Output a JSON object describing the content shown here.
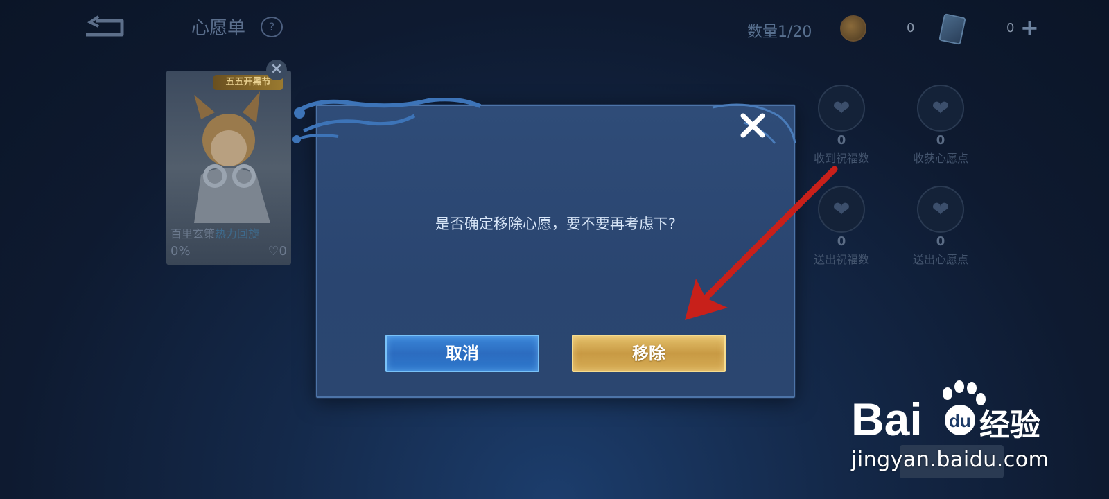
{
  "header": {
    "title": "心愿单",
    "help_icon_glyph": "?",
    "count_label": "数量1/20",
    "coin_value": "0",
    "card_value": "0",
    "add_glyph": "+"
  },
  "hero_card": {
    "badge": "五五开黑节",
    "name": "百里玄策",
    "skin": "热力回旋",
    "progress": "0%",
    "likes": "0",
    "close_glyph": "×"
  },
  "stats": [
    {
      "value": "0",
      "label": "收到祝福数"
    },
    {
      "value": "0",
      "label": "收获心愿点"
    },
    {
      "value": "0",
      "label": "送出祝福数"
    },
    {
      "value": "0",
      "label": "送出心愿点"
    }
  ],
  "dialog": {
    "message": "是否确定移除心愿，要不要再考虑下?",
    "cancel_label": "取消",
    "remove_label": "移除"
  },
  "watermark": {
    "brand": "Baidu经验",
    "url": "jingyan.baidu.com"
  },
  "colors": {
    "cancel_button": "#2f74c8",
    "remove_button": "#d4aa55",
    "annotation_arrow": "#c8201a",
    "dialog_bg": "#2d4a75"
  },
  "icons": [
    "back-icon",
    "help-icon",
    "coin-icon",
    "card-icon",
    "add-icon",
    "close-icon",
    "heart-icon",
    "heart-hand-icon"
  ]
}
